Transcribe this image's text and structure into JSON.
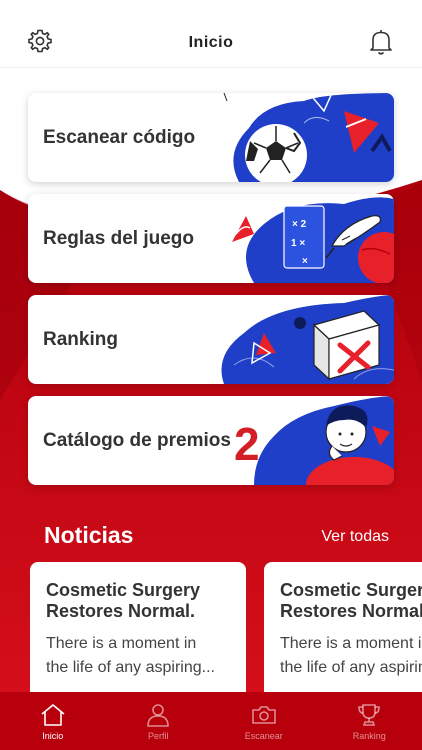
{
  "header": {
    "title": "Inicio",
    "settings_icon": "gear-icon",
    "notifications_icon": "bell-icon"
  },
  "menu": {
    "items": [
      {
        "label": "Escanear código",
        "art": "soccer-ball"
      },
      {
        "label": "Reglas del juego",
        "art": "tactics-board"
      },
      {
        "label": "Ranking",
        "art": "x-mark-box"
      },
      {
        "label": "Catálogo de premios",
        "art": "thinking-person"
      }
    ]
  },
  "news": {
    "title": "Noticias",
    "see_all": "Ver todas",
    "articles": [
      {
        "title_line1": "Cosmetic Surgery",
        "title_line2": "Restores Normal.",
        "excerpt_line1": "There is a moment in",
        "excerpt_line2": "the life of any aspiring..."
      },
      {
        "title_line1": "Cosmetic Surgery",
        "title_line2": "Restores Normal.",
        "excerpt_line1": "There is a moment in",
        "excerpt_line2": "the life of any aspiring..."
      }
    ]
  },
  "tabbar": {
    "tabs": [
      {
        "label": "Inicio",
        "icon": "home-icon",
        "active": true
      },
      {
        "label": "Perfil",
        "icon": "person-icon",
        "active": false
      },
      {
        "label": "Escanear",
        "icon": "camera-icon",
        "active": false
      },
      {
        "label": "Ranking",
        "icon": "trophy-icon",
        "active": false
      }
    ]
  },
  "colors": {
    "brand_red": "#c8000f",
    "dark_red": "#8e0009",
    "art_blue": "#1f3fc8"
  }
}
